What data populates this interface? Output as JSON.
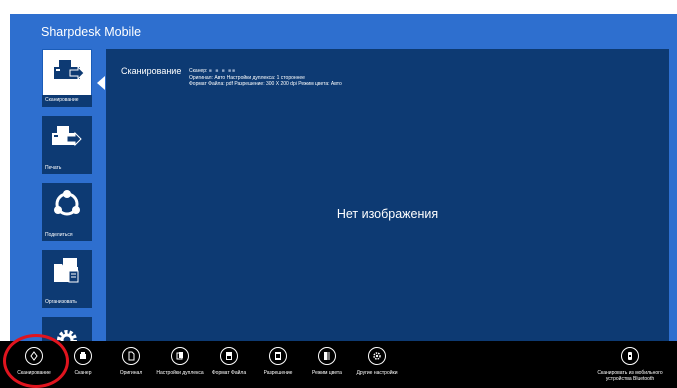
{
  "app": {
    "title": "Sharpdesk Mobile"
  },
  "sidebar": {
    "items": [
      {
        "label": "Сканирование",
        "icon": "scanner-icon",
        "selected": true
      },
      {
        "label": "Печать",
        "icon": "printer-icon",
        "selected": false
      },
      {
        "label": "Поделиться",
        "icon": "share-icon",
        "selected": false
      },
      {
        "label": "Организовать",
        "icon": "folder-icon",
        "selected": false
      },
      {
        "label": "",
        "icon": "gear-icon",
        "selected": false
      }
    ]
  },
  "main": {
    "heading": "Сканирование",
    "details": {
      "line1": "Сканер: ",
      "line1_masked": "■ ■ ■  ■■",
      "line2": "Оригинал: Авто  Настройки дуплекса: 1 стороннее",
      "line3": "Формат Файла: pdf   Разрешение: 300 X 200 dpi   Режим цвета: Авто"
    },
    "empty_message": "Нет изображения"
  },
  "appbar": {
    "buttons": [
      {
        "label": "Сканирование",
        "icon": "scan-icon"
      },
      {
        "label": "Сканер",
        "icon": "scanner-select-icon"
      },
      {
        "label": "Оригинал",
        "icon": "document-icon"
      },
      {
        "label": "Настройки дуплекса",
        "icon": "duplex-icon"
      },
      {
        "label": "Формат Файла",
        "icon": "file-format-icon"
      },
      {
        "label": "Разрешение",
        "icon": "resolution-icon"
      },
      {
        "label": "Режим цвета",
        "icon": "color-mode-icon"
      },
      {
        "label": "Другие настройки",
        "icon": "settings-icon"
      }
    ],
    "right_button": {
      "label": "Сканировать из мобильного устройства Bluetooth",
      "icon": "mobile-scan-icon"
    }
  },
  "colors": {
    "background": "#2e6fcf",
    "panel": "#0d3a73",
    "appbar": "#000000",
    "highlight": "#e0141e"
  }
}
